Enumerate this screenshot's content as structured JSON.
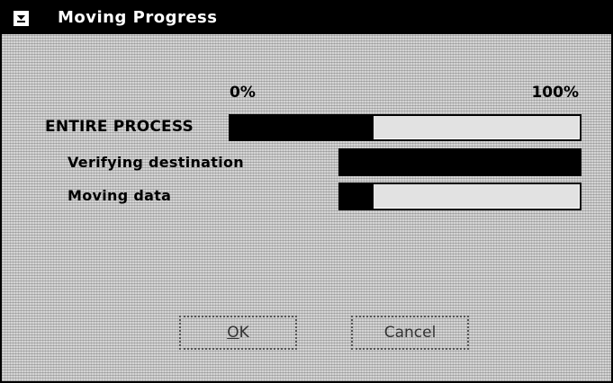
{
  "window": {
    "title": "Moving Progress",
    "system_menu_icon": "minimize-arrow-icon"
  },
  "scale": {
    "start_label": "0%",
    "end_label": "100%"
  },
  "progress": {
    "entire_process": {
      "label": "ENTIRE PROCESS",
      "value_percent": 41
    },
    "verifying_destination": {
      "label": "Verifying destination",
      "value_percent": 100
    },
    "moving_data": {
      "label": "Moving data",
      "value_percent": 14
    }
  },
  "buttons": {
    "ok_label": "OK",
    "ok_mnemonic": "O",
    "ok_rest": "K",
    "cancel_label": "Cancel"
  },
  "colors": {
    "titlebar_bg": "#000000",
    "title_text": "#ffffff",
    "bar_fill": "#000000",
    "dialog_bg": "#d4d4d4"
  }
}
